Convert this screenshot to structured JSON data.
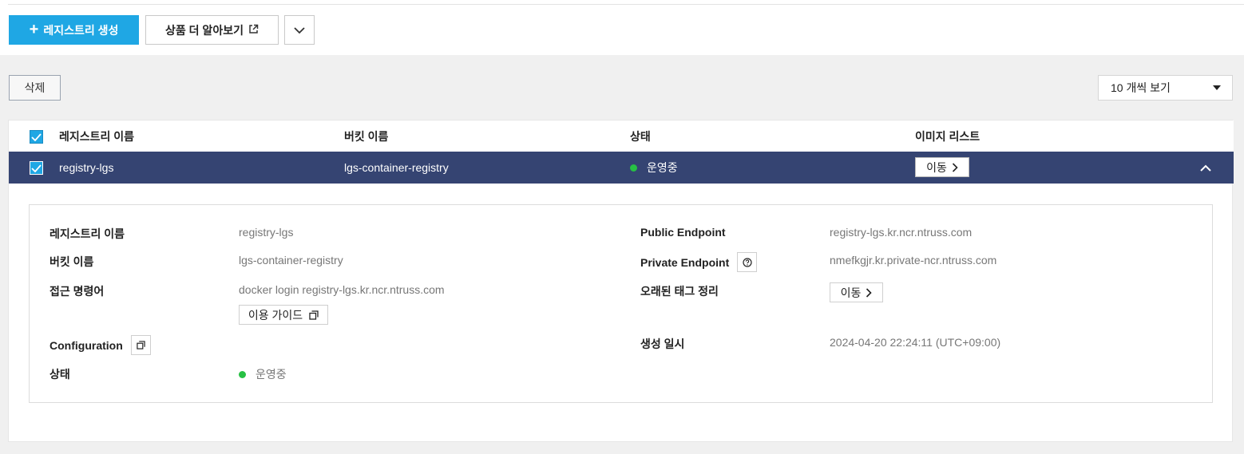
{
  "toolbar": {
    "create_label": "레지스트리 생성",
    "learn_label": "상품 더 알아보기",
    "delete_label": "삭제",
    "view_select": "10 개씩 보기"
  },
  "table": {
    "headers": [
      "레지스트리 이름",
      "버킷 이름",
      "상태",
      "이미지 리스트"
    ],
    "rows": [
      {
        "name": "registry-lgs",
        "bucket": "lgs-container-registry",
        "status": "운영중",
        "image_list_button": "이동",
        "selected": true,
        "expanded": true
      }
    ]
  },
  "detail": {
    "registry_name_label": "레지스트리 이름",
    "registry_name": "registry-lgs",
    "bucket_label": "버킷 이름",
    "bucket": "lgs-container-registry",
    "access_cmd_label": "접근 명령어",
    "access_cmd": "docker login registry-lgs.kr.ncr.ntruss.com",
    "guide_button": "이용 가이드",
    "configuration_label": "Configuration",
    "status_label": "상태",
    "status": "운영중",
    "public_endpoint_label": "Public Endpoint",
    "public_endpoint": "registry-lgs.kr.ncr.ntruss.com",
    "private_endpoint_label": "Private Endpoint",
    "private_endpoint": "nmefkgjr.kr.private-ncr.ntruss.com",
    "old_tag_label": "오래된 태그 정리",
    "old_tag_button": "이동",
    "created_label": "생성 일시",
    "created": "2024-04-20 22:24:11 (UTC+09:00)"
  },
  "colors": {
    "primary": "#1fa7e4",
    "selected_row": "#354472",
    "status_running": "#27c044"
  },
  "icons": [
    "plus-icon",
    "external-link-icon",
    "chevron-down-icon",
    "checkbox-checked-icon",
    "chevron-right-icon",
    "chevron-up-icon",
    "copy-icon",
    "help-icon"
  ]
}
